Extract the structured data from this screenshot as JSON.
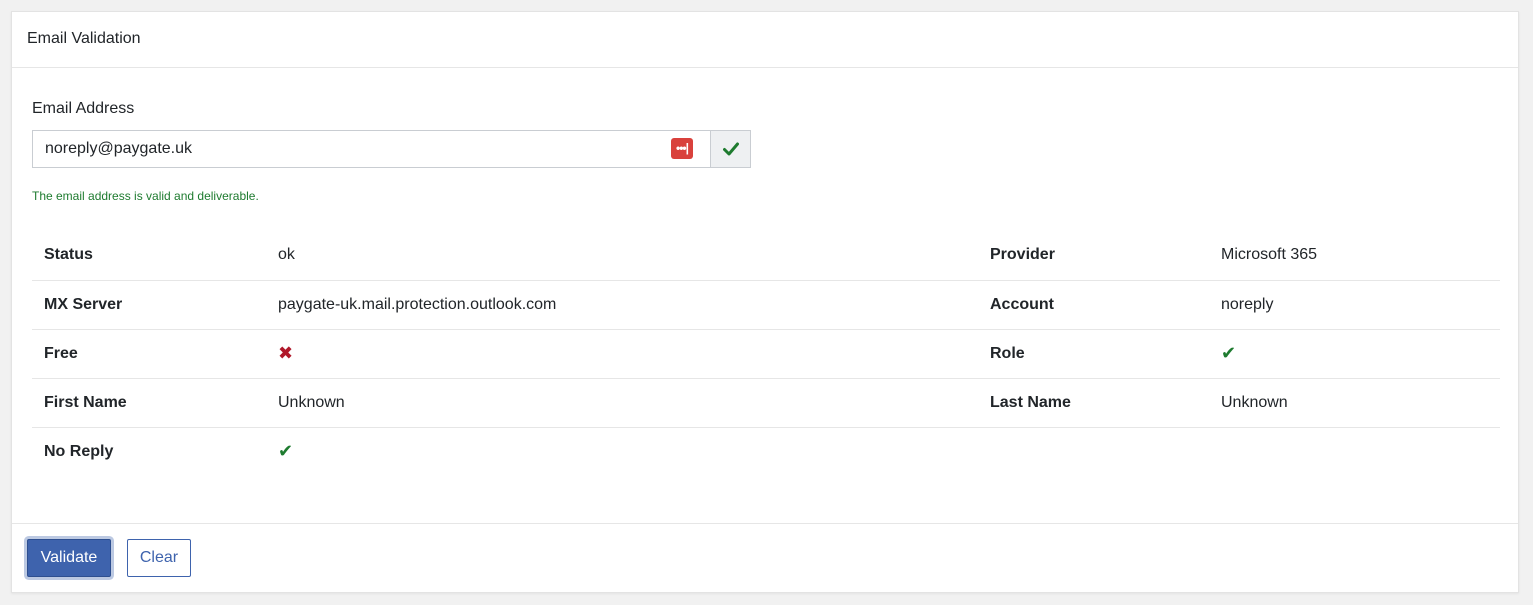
{
  "card": {
    "title": "Email Validation"
  },
  "form": {
    "email_label": "Email Address",
    "email_value": "noreply@paygate.uk",
    "password_manager_icon": "•••|",
    "status_icon": "check-icon",
    "valid_message": "The email address is valid and deliverable."
  },
  "details": {
    "rows": [
      {
        "k1": "Status",
        "v1": "ok",
        "k2": "Provider",
        "v2": "Microsoft 365"
      },
      {
        "k1": "MX Server",
        "v1": "paygate-uk.mail.protection.outlook.com",
        "k2": "Account",
        "v2": "noreply"
      },
      {
        "k1": "Free",
        "v1_icon": "cross-icon",
        "v1": "✖",
        "k2": "Role",
        "v2_icon": "check-icon",
        "v2": "✔"
      },
      {
        "k1": "First Name",
        "v1": "Unknown",
        "k2": "Last Name",
        "v2": "Unknown"
      },
      {
        "k1": "No Reply",
        "v1_icon": "check-icon",
        "v1": "✔",
        "k2": "",
        "v2": ""
      }
    ]
  },
  "footer": {
    "validate_label": "Validate",
    "clear_label": "Clear"
  },
  "colors": {
    "primary": "#3e63ad",
    "success": "#1e7b2f",
    "danger": "#b0182a",
    "password_manager": "#d9413c"
  }
}
